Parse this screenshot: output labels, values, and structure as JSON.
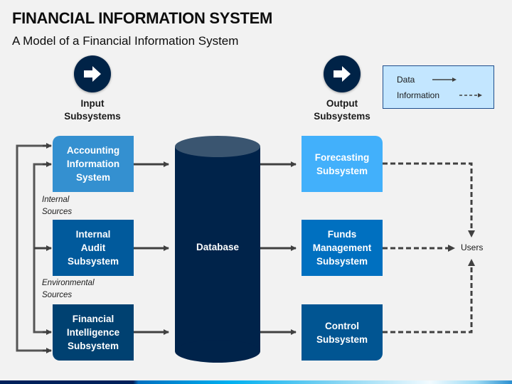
{
  "title": "FINANCIAL INFORMATION SYSTEM",
  "subtitle": "A Model of a Financial Information System",
  "headers": {
    "input": "Input\nSubsystems",
    "output": "Output\nSubsystems"
  },
  "legend": {
    "data": "Data",
    "information": "Information"
  },
  "input_subsystems": [
    {
      "label": "Accounting\nInformation\nSystem",
      "color": "#3490d0"
    },
    {
      "label": "Internal\nAudit\nSubsystem",
      "color": "#015a9c"
    },
    {
      "label": "Financial\nIntelligence\nSubsystem",
      "color": "#004171"
    }
  ],
  "sources": {
    "internal": "Internal\nSources",
    "environmental": "Environmental\nSources"
  },
  "database": {
    "label": "Database",
    "color": "#00234a",
    "top_color": "#3a5570"
  },
  "output_subsystems": [
    {
      "label": "Forecasting\nSubsystem",
      "color": "#42b0fb"
    },
    {
      "label": "Funds\nManagement\nSubsystem",
      "color": "#0070c0"
    },
    {
      "label": "Control\nSubsystem",
      "color": "#015592"
    }
  ],
  "users": "Users",
  "colors": {
    "arrow": "#404040",
    "icon_circle": "#002347"
  }
}
